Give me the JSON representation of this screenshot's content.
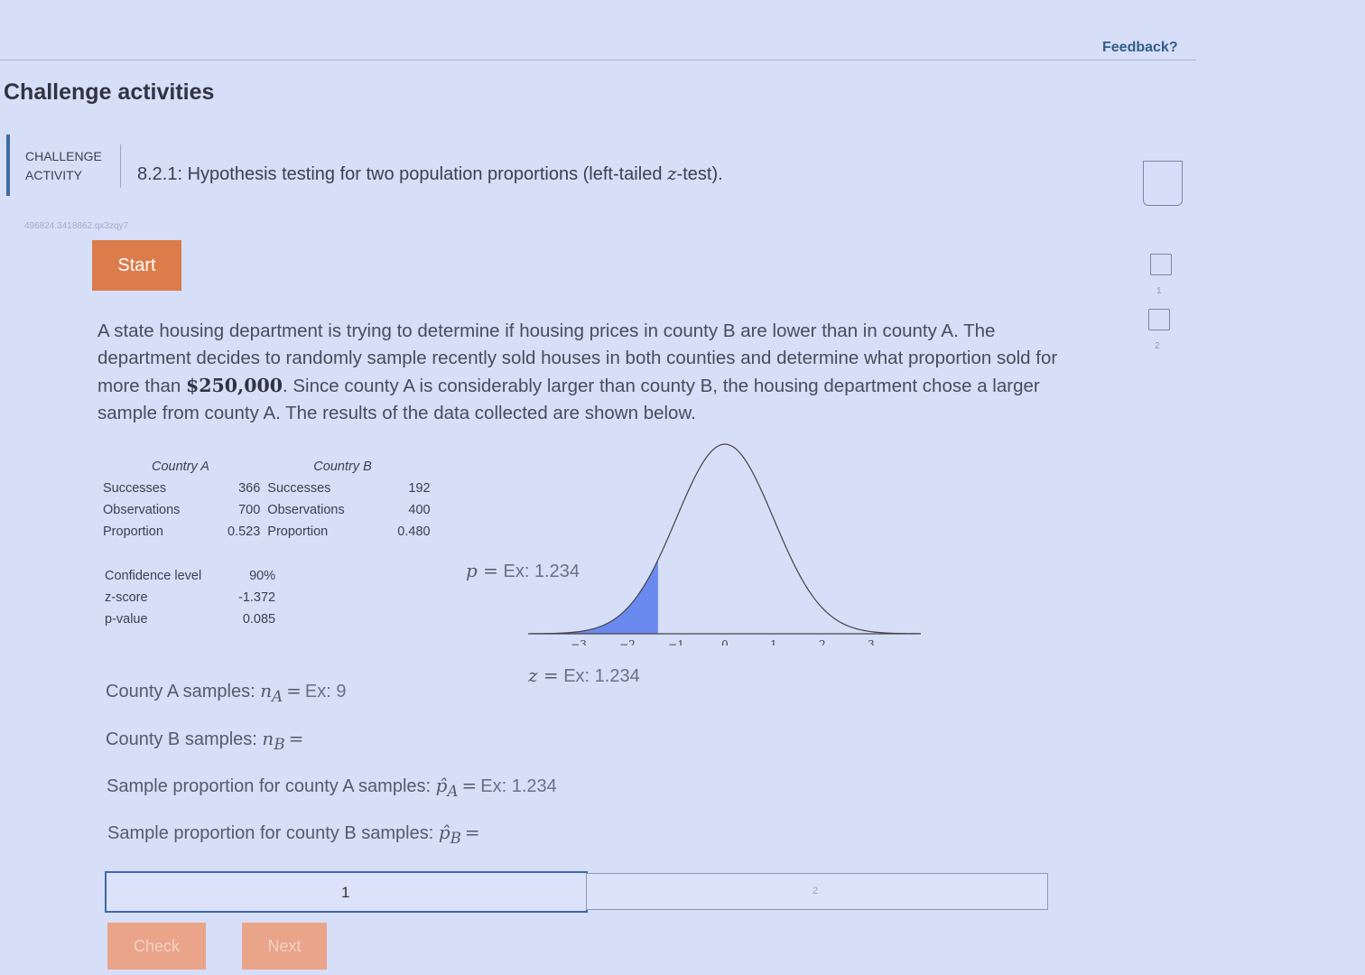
{
  "header": {
    "feedback_label": "Feedback?"
  },
  "section": {
    "title": "Challenge activities"
  },
  "activity": {
    "label_line1": "CHALLENGE",
    "label_line2": "ACTIVITY",
    "title_prefix": "8.2.1: Hypothesis testing for two population proportions (left-tailed ",
    "title_var": "z",
    "title_suffix": "-test).",
    "id_code": "496824.3418862.qx3zqy7",
    "start_label": "Start"
  },
  "problem": {
    "text_before": "A state housing department is trying to determine if housing prices in county B are lower than in county A. The department decides to randomly sample recently sold houses in both counties and determine what proportion sold for more than ",
    "amount": "$250,000",
    "text_after": ". Since county A is considerably larger than county B, the housing department chose a larger sample from county A. The results of the data collected are shown below."
  },
  "data_table": {
    "header_a": "Country A",
    "header_b": "Country B",
    "rows": [
      {
        "label_a": "Successes",
        "value_a": "366",
        "label_b": "Successes",
        "value_b": "192"
      },
      {
        "label_a": "Observations",
        "value_a": "700",
        "label_b": "Observations",
        "value_b": "400"
      },
      {
        "label_a": "Proportion",
        "value_a": "0.523",
        "label_b": "Proportion",
        "value_b": "0.480"
      }
    ]
  },
  "stats_table": {
    "rows": [
      {
        "label": "Confidence level",
        "value": "90%"
      },
      {
        "label": "z-score",
        "value": "-1.372"
      },
      {
        "label": "p-value",
        "value": "0.085"
      }
    ]
  },
  "graph": {
    "p_label": "p =",
    "p_placeholder": "Ex: 1.234",
    "z_label": "z =",
    "z_placeholder": "Ex: 1.234",
    "ticks": [
      "−3",
      "−2",
      "−1",
      "0",
      "1",
      "2",
      "3"
    ],
    "shade_color": "#6b8af0"
  },
  "questions": {
    "na_prefix": "County A samples: ",
    "na_var": "n",
    "na_sub": "A",
    "na_placeholder": "Ex: 9",
    "nb_prefix": "County B samples: ",
    "nb_var": "n",
    "nb_sub": "B",
    "pa_prefix": "Sample proportion for county A samples: ",
    "pa_var": "p̂",
    "pa_sub": "A",
    "pa_placeholder": "Ex: 1.234",
    "pb_prefix": "Sample proportion for county B samples: ",
    "pb_var": "p̂",
    "pb_sub": "B",
    "equals": "="
  },
  "progress": {
    "step1": "1",
    "step2": "2"
  },
  "buttons": {
    "check_label": "Check",
    "next_label": "Next"
  },
  "side_nav": {
    "num1": "1",
    "num2": "2"
  }
}
